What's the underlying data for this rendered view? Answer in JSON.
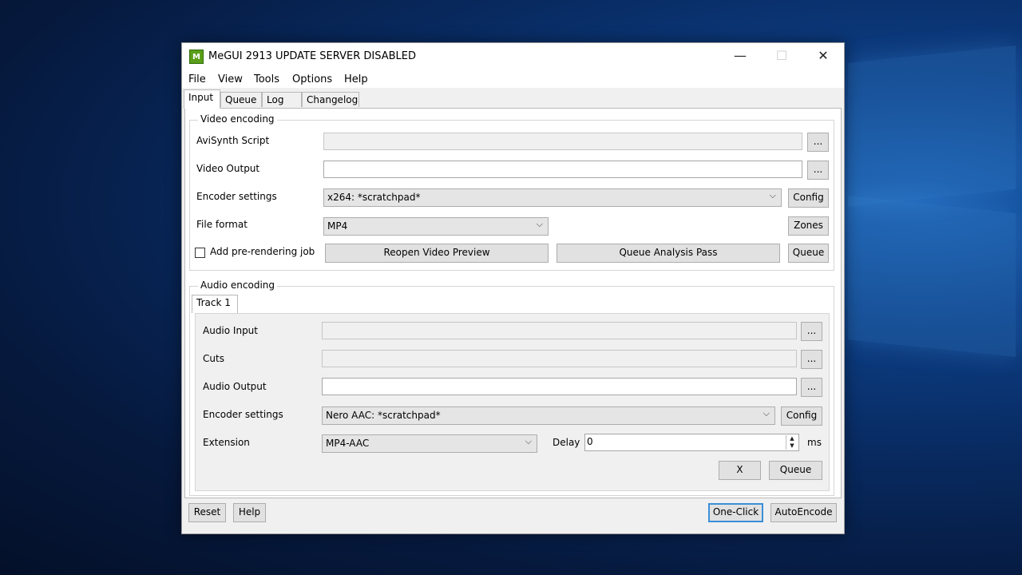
{
  "window": {
    "title": "MeGUI 2913 UPDATE SERVER DISABLED"
  },
  "menu": [
    "File",
    "View",
    "Tools",
    "Options",
    "Help"
  ],
  "tabs": [
    "Input",
    "Queue",
    "Log",
    "Changelog"
  ],
  "video": {
    "group_title": "Video encoding",
    "avisynth_label": "AviSynth Script",
    "avisynth_value": "",
    "output_label": "Video Output",
    "output_value": "",
    "encoder_label": "Encoder settings",
    "encoder_value": "x264: *scratchpad*",
    "format_label": "File format",
    "format_value": "MP4",
    "prerender_label": "Add pre-rendering job",
    "browse": "...",
    "config": "Config",
    "zones": "Zones",
    "reopen": "Reopen Video Preview",
    "analysis": "Queue Analysis Pass",
    "queue": "Queue"
  },
  "audio": {
    "group_title": "Audio encoding",
    "track_tab": "Track 1",
    "input_label": "Audio Input",
    "input_value": "",
    "cuts_label": "Cuts",
    "cuts_value": "",
    "output_label": "Audio Output",
    "output_value": "",
    "encoder_label": "Encoder settings",
    "encoder_value": "Nero AAC: *scratchpad*",
    "ext_label": "Extension",
    "ext_value": "MP4-AAC",
    "delay_label": "Delay",
    "delay_value": "0",
    "ms": "ms",
    "browse": "...",
    "config": "Config",
    "x": "X",
    "queue": "Queue"
  },
  "bottom": {
    "reset": "Reset",
    "help": "Help",
    "oneclick": "One-Click",
    "autoencode": "AutoEncode"
  },
  "icons": {
    "app": "megui-app-icon"
  }
}
